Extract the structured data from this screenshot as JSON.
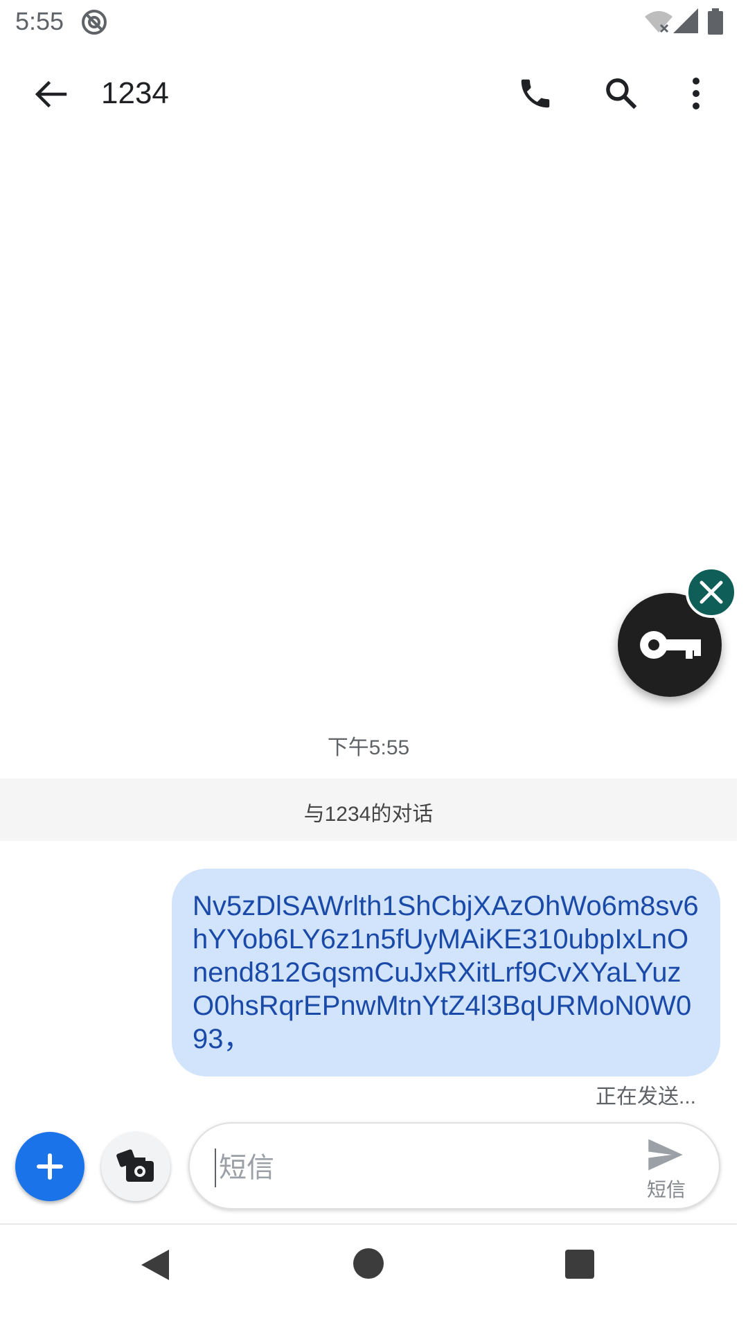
{
  "status_bar": {
    "time": "5:55"
  },
  "top_bar": {
    "title": "1234"
  },
  "conversation": {
    "timestamp": "下午5:55",
    "header": "与1234的对话",
    "message": {
      "text": "Nv5zDlSAWrlth1ShCbjXAzOhWo6m8sv6hYYob6LY6z1n5fUyMAiKE310ubpIxLnOnend812GqsmCuJxRXitLrf9CvXYaLYuzO0hsRqrEPnwMtnYtZ4l3BqURMoN0W093，",
      "status": "正在发送..."
    }
  },
  "compose": {
    "placeholder": "短信",
    "send_label": "短信"
  },
  "colors": {
    "accent": "#1a73e8",
    "bubble": "#d2e3fc",
    "bubble_text": "#1a4aa8",
    "key_close": "#0f5e57"
  }
}
